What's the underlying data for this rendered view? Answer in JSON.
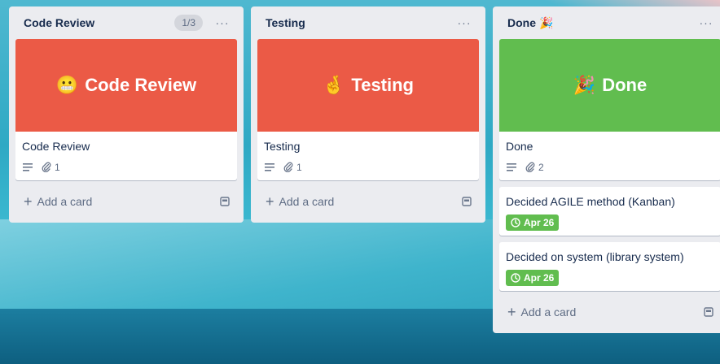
{
  "lists": [
    {
      "title": "Code Review",
      "count": "1/3",
      "menu": "···",
      "cover_emoji": "😬",
      "cover_text": "Code Review",
      "card_title": "Code Review",
      "attachments": "1",
      "add_label": "Add a card"
    },
    {
      "title": "Testing",
      "menu": "···",
      "cover_emoji": "🤞",
      "cover_text": "Testing",
      "card_title": "Testing",
      "attachments": "1",
      "add_label": "Add a card"
    },
    {
      "title": "Done",
      "title_emoji": "🎉",
      "menu": "···",
      "cover_emoji": "🎉",
      "cover_text": "Done",
      "card_title": "Done",
      "attachments": "2",
      "cards": [
        {
          "title": "Decided AGILE method (Kanban)",
          "date": "Apr 26"
        },
        {
          "title": "Decided on system (library system)",
          "date": "Apr 26"
        }
      ],
      "add_label": "Add a card"
    }
  ],
  "colors": {
    "cover_red": "#eb5a46",
    "cover_green": "#61bd4f",
    "list_bg": "#ebecf0"
  },
  "icons": {
    "description": "lines-icon",
    "attachment": "paperclip-icon",
    "clock": "clock-icon",
    "template": "template-icon",
    "plus": "plus-icon"
  }
}
